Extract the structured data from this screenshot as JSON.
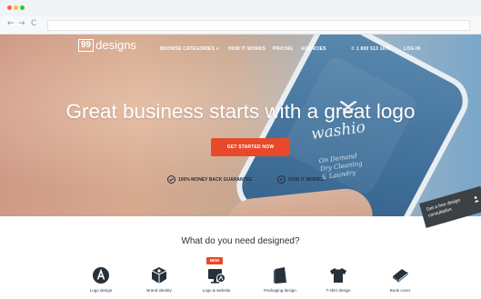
{
  "colors": {
    "accent": "#e8492b",
    "dark_text": "#27313a",
    "chrome_bg": "#f2f3f5",
    "traffic_red": "#ff5f57",
    "traffic_yellow": "#febc2e",
    "traffic_green": "#28c840"
  },
  "browser": {
    "back_icon": "arrow-left-icon",
    "forward_icon": "arrow-right-icon",
    "reload_icon": "reload-icon",
    "back_glyph": "←",
    "forward_glyph": "→",
    "reload_glyph": "C"
  },
  "header": {
    "logo_mark": "99",
    "logo_word": "designs",
    "nav": {
      "browse": "BROWSE CATEGORIES",
      "how": "HOW IT WORKS",
      "pricing": "PRICING",
      "agencies": "AGENCIES",
      "phone": "1 800 513 1678",
      "login": "LOG IN"
    }
  },
  "hero": {
    "brand_word": "washio",
    "brand_tagline": [
      "On Demand",
      "Dry Cleaning",
      "& Laundry"
    ],
    "headline": "Great business starts with a great logo",
    "cta": "GET STARTED NOW",
    "guarantee": "100% MONEY BACK GUARANTEE",
    "how_it_works": "HOW IT WORKS"
  },
  "side_tab": {
    "line1": "Get a free design",
    "line2": "consultation"
  },
  "designed": {
    "title": "What do you need designed?",
    "new_badge": "NEW",
    "items": [
      {
        "label": "Logo design",
        "icon": "logo-design-icon"
      },
      {
        "label": "Brand identity",
        "icon": "brand-identity-icon"
      },
      {
        "label": "Logo & website",
        "icon": "logo-website-icon"
      },
      {
        "label": "Packaging design",
        "icon": "packaging-design-icon"
      },
      {
        "label": "T-shirt design",
        "icon": "tshirt-design-icon"
      },
      {
        "label": "Book cover",
        "icon": "book-cover-icon"
      }
    ]
  }
}
